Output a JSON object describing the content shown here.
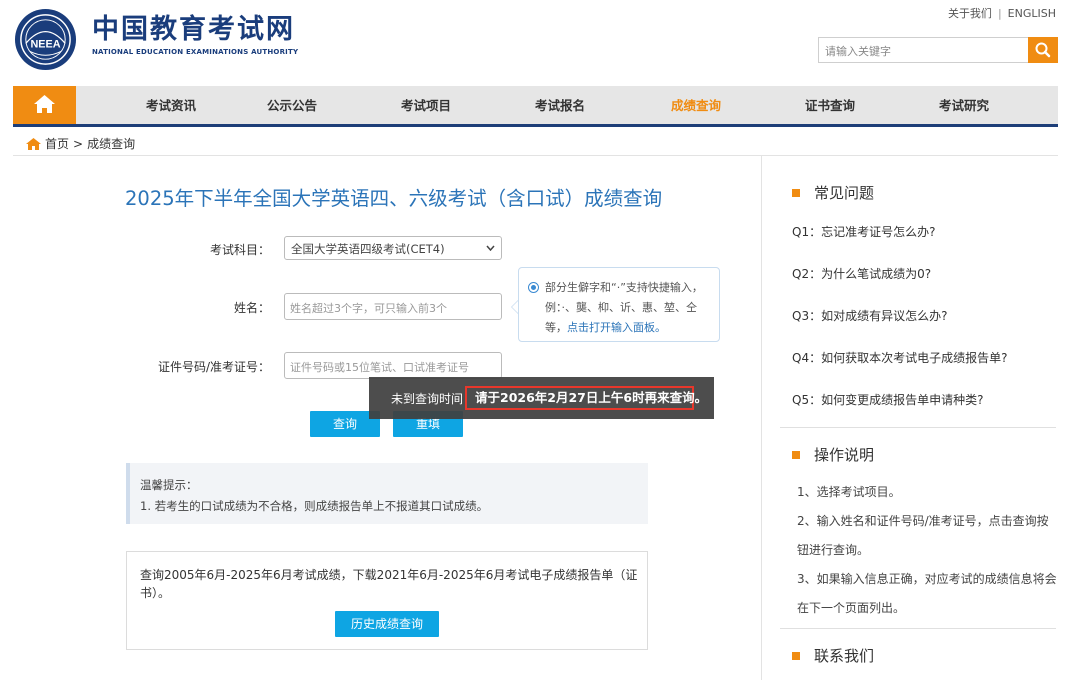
{
  "header": {
    "top_links": [
      "关于我们",
      "ENGLISH"
    ],
    "top_sep": "|",
    "logo_text": "NEEA",
    "brand_cn": "中国教育考试网",
    "brand_en": "NATIONAL EDUCATION EXAMINATIONS AUTHORITY",
    "search_placeholder": "请输入关键字"
  },
  "nav": {
    "items": [
      "考试资讯",
      "公示公告",
      "考试项目",
      "考试报名",
      "成绩查询",
      "证书查询",
      "考试研究"
    ],
    "active": "成绩查询"
  },
  "breadcrumb": {
    "home": "首页",
    "sep": ">",
    "current": "成绩查询"
  },
  "form": {
    "title": "2025年下半年全国大学英语四、六级考试（含口试）成绩查询",
    "subject_label": "考试科目：",
    "subject_value": "全国大学英语四级考试(CET4)",
    "name_label": "姓名：",
    "name_placeholder": "姓名超过3个字，可只输入前3个",
    "id_label": "证件号码/准考证号：",
    "id_placeholder": "证件号码或15位笔试、口试准考证号",
    "tip_text": "部分生僻字和“·”支持快捷输入，例：·、龑、枊、䜣、惠、堃、仝等，",
    "tip_link": "点击打开输入面板。",
    "query_button": "查询",
    "reset_button": "重填"
  },
  "toast": {
    "prefix": "未到查询时间",
    "message": "请于2026年2月27日上午6时再来查询。"
  },
  "notice": {
    "title": "温馨提示：",
    "item": "1. 若考生的口试成绩为不合格，则成绩报告单上不报道其口试成绩。"
  },
  "history": {
    "text": "查询2005年6月-2025年6月考试成绩，下载2021年6月-2025年6月考试电子成绩报告单（证书）。",
    "button": "历史成绩查询"
  },
  "sidebar": {
    "faq_title": "常见问题",
    "faq": [
      "Q1：忘记准考证号怎么办?",
      "Q2：为什么笔试成绩为0?",
      "Q3：如对成绩有异议怎么办?",
      "Q4：如何获取本次考试电子成绩报告单?",
      "Q5：如何变更成绩报告单申请种类?"
    ],
    "ops_title": "操作说明",
    "ops": [
      "1、选择考试项目。",
      "2、输入姓名和证件号码/准考证号，点击查询按钮进行查询。",
      "3、如果输入信息正确，对应考试的成绩信息将会在下一个页面列出。"
    ],
    "contact_title": "联系我们"
  },
  "colors": {
    "accent": "#f08c12",
    "nav_border": "#1d3e78",
    "title_blue": "#2b74b8",
    "button_blue": "#0ea5e3",
    "highlight_red": "#e8372b"
  }
}
